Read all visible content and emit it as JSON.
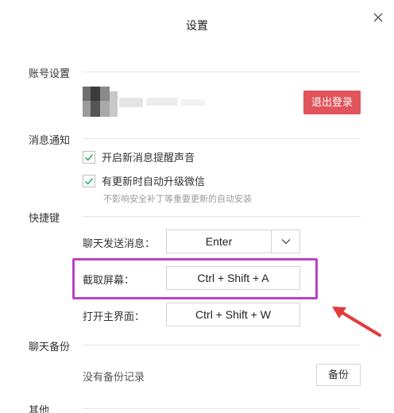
{
  "window": {
    "title": "设置"
  },
  "account": {
    "section_label": "账号设置",
    "logout_label": "退出登录"
  },
  "notifications": {
    "section_label": "消息通知",
    "options": [
      {
        "label": "开启新消息提醒声音",
        "checked": true
      },
      {
        "label": "有更新时自动升级微信",
        "checked": true
      }
    ],
    "hint": "不影响安全补丁等重要更新的自动安装"
  },
  "shortcuts": {
    "section_label": "快捷键",
    "send_message": {
      "label": "聊天发送消息：",
      "value": "Enter"
    },
    "screenshot": {
      "label": "截取屏幕：",
      "value": "Ctrl + Shift + A"
    },
    "open_main": {
      "label": "打开主界面：",
      "value": "Ctrl + Shift + W"
    }
  },
  "backup": {
    "section_label": "聊天备份",
    "status": "没有备份记录",
    "backup_label": "备份"
  },
  "other": {
    "section_label": "其他"
  },
  "colors": {
    "logout_button": "#e0545a",
    "highlight_box": "#b944c4",
    "annotation_arrow": "#e23a3a",
    "check_mark": "#2aae67"
  }
}
